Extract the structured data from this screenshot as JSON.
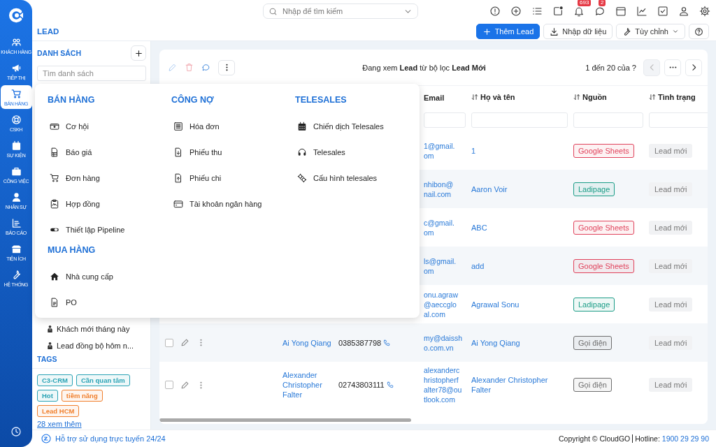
{
  "nav": {
    "items": [
      {
        "label": "KHÁCH HÀNG",
        "selected": false
      },
      {
        "label": "TIẾP THỊ",
        "selected": false
      },
      {
        "label": "BÁN HÀNG",
        "selected": true
      },
      {
        "label": "CSKH",
        "selected": false
      },
      {
        "label": "SỰ KIỆN",
        "selected": false
      },
      {
        "label": "CÔNG VIỆC",
        "selected": false
      },
      {
        "label": "NHÂN SỰ",
        "selected": false
      },
      {
        "label": "BÁO CÁO",
        "selected": false
      },
      {
        "label": "TIỆN ÍCH",
        "selected": false
      },
      {
        "label": "HỆ THỐNG",
        "selected": false
      }
    ]
  },
  "topbar": {
    "search": {
      "placeholder": "Nhập để tìm kiếm"
    },
    "notification_count": "693",
    "message_count": "2"
  },
  "page": {
    "title": "LEAD",
    "buttons": [
      {
        "label": "Thêm Lead",
        "kind": "primary"
      },
      {
        "label": "Nhập dữ liệu",
        "kind": "import"
      },
      {
        "label": "Tùy chỉnh",
        "kind": "dropdown"
      }
    ]
  },
  "lists": {
    "title": "DANH SÁCH",
    "search": {
      "placeholder": "Tìm danh sách"
    },
    "items": [
      "Khách mới tháng này",
      "Lead đồng bộ hôm n..."
    ]
  },
  "tags": {
    "title": "TAGS",
    "items": [
      {
        "label": "C3-CRM",
        "color": "#2aa3b5"
      },
      {
        "label": "Cần quan tâm",
        "color": "#2aa3b5"
      },
      {
        "label": "Hot",
        "color": "#2aa3b5"
      },
      {
        "label": "tiềm năng",
        "color": "#f0802e"
      },
      {
        "label": "Lead HCM",
        "color": "#f0802e"
      }
    ],
    "more": "28 xem thêm"
  },
  "table": {
    "summary": "Đang xem **Lead** từ bộ lọc **Lead Mới**",
    "range": "1 đến 20 của ?",
    "columns": [
      {
        "label": "Email",
        "sortable": false
      },
      {
        "label": "Họ và tên",
        "sortable": true
      },
      {
        "label": "Nguồn",
        "sortable": true
      },
      {
        "label": "Tình trạng",
        "sortable": true
      }
    ],
    "rows": [
      {
        "email": "1@gmail.\nom",
        "full_name": "1",
        "source": {
          "label": "Google Sheets",
          "color": "#e0435c"
        },
        "status": "Lead mới"
      },
      {
        "email": "nhibon@\nnail.com",
        "full_name": "Aaron Voir",
        "source": {
          "label": "Ladipage",
          "color": "#1a9c86"
        },
        "status": "Lead mới"
      },
      {
        "email": "c@gmail.\nom",
        "full_name": "ABC",
        "source": {
          "label": "Google Sheets",
          "color": "#e0435c"
        },
        "status": "Lead mới"
      },
      {
        "email": "ls@gmail.\nom",
        "full_name": "add",
        "source": {
          "label": "Google Sheets",
          "color": "#e0435c"
        },
        "status": "Lead mới"
      },
      {
        "email": "onu.agraw\n@aeccglo\nal.com",
        "full_name": "Agrawal Sonu",
        "source": {
          "label": "Ladipage",
          "color": "#1a9c86"
        },
        "status": "Lead mới"
      },
      {
        "selected": false,
        "name": "Ai Yong Qiang",
        "phone": "0385387798",
        "email": "my@daissh\no.com.vn",
        "full_name": "Ai Yong Qiang",
        "source": {
          "label": "Gọi điện",
          "color": "#6e6e6e"
        },
        "status": "Lead mới"
      },
      {
        "selected": false,
        "name": "Alexander Christopher Falter",
        "phone": "02743803111",
        "email": "alexanderc\nhristopherf\nalter78@ou\ntlook.com",
        "full_name": "Alexander Christopher Falter",
        "source": {
          "label": "Gọi điện",
          "color": "#6e6e6e"
        },
        "status": "Lead mới"
      }
    ]
  },
  "menu": {
    "columns": [
      {
        "groups": [
          {
            "title": "BÁN HÀNG",
            "items": [
              "Cơ hội",
              "Báo giá",
              "Đơn hàng",
              "Hợp đồng",
              "Thiết lập Pipeline"
            ]
          },
          {
            "title": "MUA HÀNG",
            "items": [
              "Nhà cung cấp",
              "PO"
            ]
          }
        ]
      },
      {
        "groups": [
          {
            "title": "CÔNG NỢ",
            "items": [
              "Hóa đơn",
              "Phiếu thu",
              "Phiếu chi",
              "Tài khoản ngân hàng"
            ]
          }
        ]
      },
      {
        "groups": [
          {
            "title": "TELESALES",
            "items": [
              "Chiến dịch Telesales",
              "Telesales",
              "Cấu hình telesales"
            ]
          }
        ]
      }
    ]
  },
  "footer": {
    "support": "Hỗ trợ sử dụng trực tuyến 24/24",
    "copyright": "Copyright © CloudGO",
    "hotline_label": "Hotline:",
    "hotline": "1900 29 29 90"
  }
}
